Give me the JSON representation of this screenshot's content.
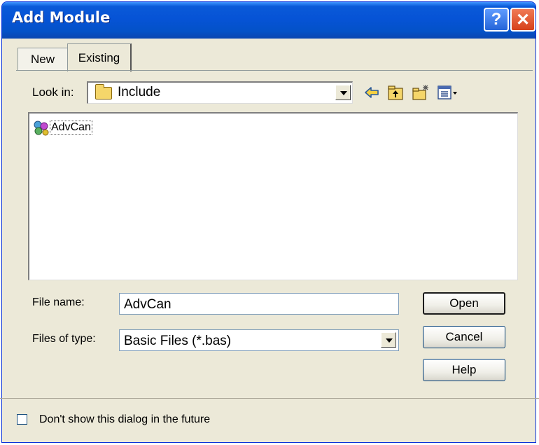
{
  "window": {
    "title": "Add Module",
    "help_glyph": "?",
    "close_glyph": "✕"
  },
  "tabs": [
    {
      "label": "New",
      "selected": false
    },
    {
      "label": "Existing",
      "selected": true
    }
  ],
  "look_in": {
    "label": "Look in:",
    "value": "Include",
    "icon": "folder-icon"
  },
  "toolbar_icons": [
    "back-arrow-icon",
    "up-one-level-icon",
    "new-folder-icon",
    "view-menu-icon"
  ],
  "file_list": {
    "items": [
      {
        "label": "AdvCan",
        "icon": "module-icon"
      }
    ]
  },
  "file_name": {
    "label": "File name:",
    "value": "AdvCan"
  },
  "files_of_type": {
    "label": "Files of type:",
    "value": "Basic Files (*.bas)"
  },
  "buttons": {
    "open": "Open",
    "cancel": "Cancel",
    "help": "Help"
  },
  "checkbox": {
    "label": "Don't show this dialog in the future",
    "checked": false
  },
  "colors": {
    "titlebar": "#0653d6",
    "dialog_bg": "#ece9d8",
    "close_button": "#d6401a",
    "help_button": "#2464d8"
  }
}
